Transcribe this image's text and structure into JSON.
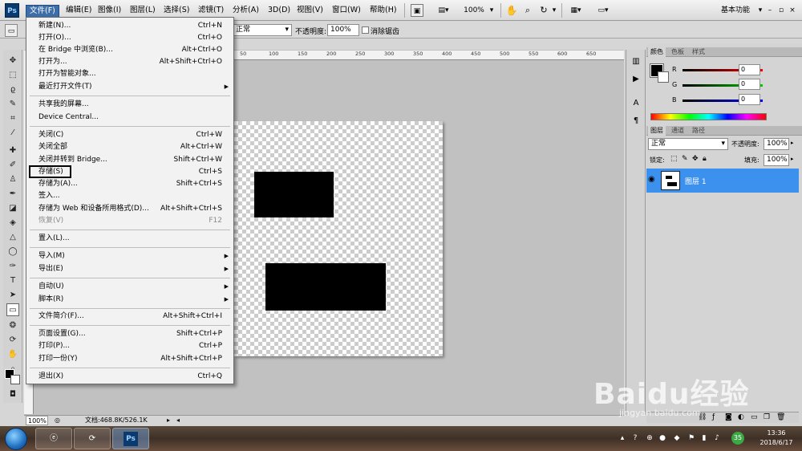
{
  "app": {
    "logo": "Ps"
  },
  "menubar": {
    "items": [
      "文件(F)",
      "编辑(E)",
      "图像(I)",
      "图层(L)",
      "选择(S)",
      "滤镜(T)",
      "分析(A)",
      "3D(D)",
      "视图(V)",
      "窗口(W)",
      "帮助(H)"
    ],
    "zoom": "100%",
    "workspace": "基本功能",
    "window_controls": [
      "–",
      "▫",
      "×"
    ]
  },
  "options_bar": {
    "mode": "正常",
    "opacity_label": "不透明度:",
    "opacity_value": "100%",
    "antialias_label": "消除锯齿"
  },
  "ruler": {
    "top_ticks": [
      "50",
      "100",
      "150",
      "200",
      "250",
      "300",
      "350",
      "400",
      "450",
      "500",
      "550",
      "600",
      "650"
    ]
  },
  "file_menu": {
    "items": [
      {
        "label": "新建(N)...",
        "shortcut": "Ctrl+N"
      },
      {
        "label": "打开(O)...",
        "shortcut": "Ctrl+O"
      },
      {
        "label": "在 Bridge 中浏览(B)...",
        "shortcut": "Alt+Ctrl+O"
      },
      {
        "label": "打开为...",
        "shortcut": "Alt+Shift+Ctrl+O"
      },
      {
        "label": "打开为智能对象...",
        "shortcut": ""
      },
      {
        "label": "最近打开文件(T)",
        "shortcut": "",
        "submenu": true
      },
      {
        "label": "共享我的屏幕...",
        "shortcut": ""
      },
      {
        "label": "Device Central...",
        "shortcut": ""
      },
      {
        "label": "关闭(C)",
        "shortcut": "Ctrl+W"
      },
      {
        "label": "关闭全部",
        "shortcut": "Alt+Ctrl+W"
      },
      {
        "label": "关闭并转到 Bridge...",
        "shortcut": "Shift+Ctrl+W"
      },
      {
        "label": "存储(S)",
        "shortcut": "Ctrl+S"
      },
      {
        "label": "存储为(A)...",
        "shortcut": "Shift+Ctrl+S"
      },
      {
        "label": "签入...",
        "shortcut": ""
      },
      {
        "label": "存储为 Web 和设备所用格式(D)...",
        "shortcut": "Alt+Shift+Ctrl+S"
      },
      {
        "label": "恢复(V)",
        "shortcut": "F12",
        "disabled": true
      },
      {
        "label": "置入(L)...",
        "shortcut": ""
      },
      {
        "label": "导入(M)",
        "shortcut": "",
        "submenu": true
      },
      {
        "label": "导出(E)",
        "shortcut": "",
        "submenu": true
      },
      {
        "label": "自动(U)",
        "shortcut": "",
        "submenu": true
      },
      {
        "label": "脚本(R)",
        "shortcut": "",
        "submenu": true
      },
      {
        "label": "文件简介(F)...",
        "shortcut": "Alt+Shift+Ctrl+I"
      },
      {
        "label": "页面设置(G)...",
        "shortcut": "Shift+Ctrl+P"
      },
      {
        "label": "打印(P)...",
        "shortcut": "Ctrl+P"
      },
      {
        "label": "打印一份(Y)",
        "shortcut": "Alt+Shift+Ctrl+P"
      },
      {
        "label": "退出(X)",
        "shortcut": "Ctrl+Q"
      }
    ]
  },
  "status_bar": {
    "zoom": "100%",
    "doc_info": "文档:468.8K/526.1K"
  },
  "color_panel": {
    "tabs": [
      "颜色",
      "色板",
      "样式"
    ],
    "channels": [
      {
        "name": "R",
        "value": "0",
        "color": "#e00000"
      },
      {
        "name": "G",
        "value": "0",
        "color": "#00b000"
      },
      {
        "name": "B",
        "value": "0",
        "color": "#0000d0"
      }
    ]
  },
  "layers_panel": {
    "tabs": [
      "图层",
      "通道",
      "路径"
    ],
    "blend_mode": "正常",
    "opacity_label": "不透明度:",
    "opacity_value": "100%",
    "lock_label": "锁定:",
    "fill_label": "填充:",
    "fill_value": "100%",
    "layer_name": "图层 1",
    "accent": "#3d91ee"
  },
  "taskbar": {
    "ps_label": "Ps",
    "time": "13:36",
    "date": "2018/6/17",
    "badge": "35"
  },
  "watermark": {
    "text": "Baidu经验",
    "url": "jingyan.baidu.com"
  }
}
